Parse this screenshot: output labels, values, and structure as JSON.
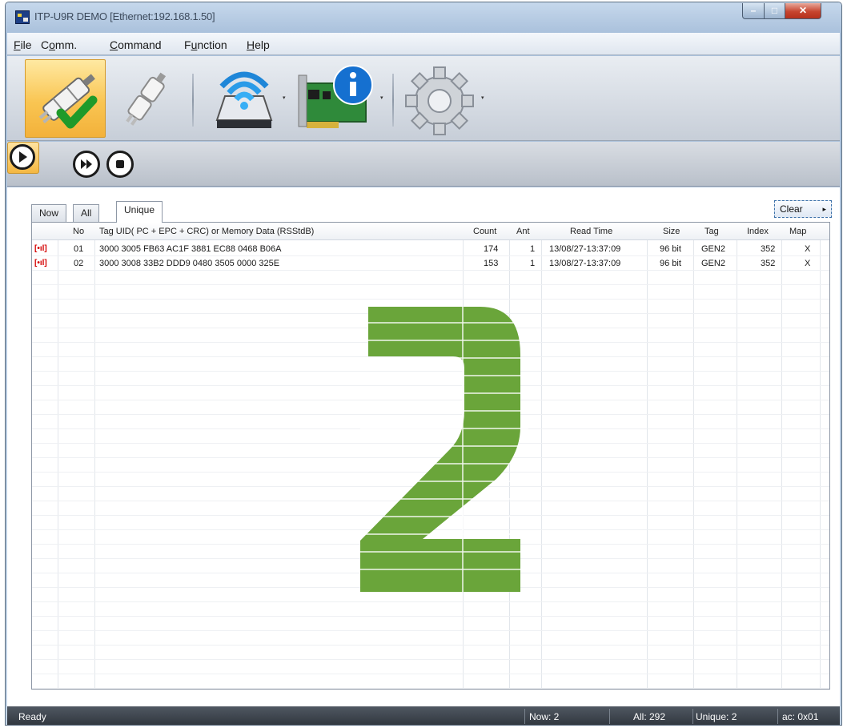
{
  "window": {
    "title": "ITP-U9R DEMO [Ethernet:192.168.1.50]"
  },
  "window_controls": {
    "minimize": "–",
    "maximize": "□",
    "close": "✕"
  },
  "menu": [
    {
      "label": "File",
      "accel": "F",
      "rest": "ile"
    },
    {
      "label": "Comm.",
      "accel": "o",
      "pre": "C",
      "rest": "mm."
    },
    {
      "label": "Command",
      "accel": "C",
      "rest": "ommand"
    },
    {
      "label": "Function",
      "accel": "u",
      "pre": "F",
      "rest": "nction"
    },
    {
      "label": "Help",
      "accel": "H",
      "rest": "elp"
    }
  ],
  "toolbar": {
    "icons": [
      "connect-icon",
      "disconnect-icon",
      "wireless-reader-icon",
      "device-info-icon",
      "settings-gear-icon"
    ],
    "dropdown_arrow": "▾"
  },
  "playback": {
    "icons": [
      "play-icon",
      "fast-forward-icon",
      "stop-icon"
    ]
  },
  "tabs": [
    {
      "label": "Now",
      "active": false
    },
    {
      "label": "All",
      "active": false
    },
    {
      "label": "Unique",
      "active": true
    }
  ],
  "clear_button": {
    "label": "Clear",
    "arrow": "▸"
  },
  "table": {
    "columns": {
      "no": "No",
      "tag": "Tag UID( PC + EPC + CRC) or Memory Data (RSStdB)",
      "count": "Count",
      "ant": "Ant",
      "read_time": "Read Time",
      "size": "Size",
      "tagtype": "Tag",
      "index": "Index",
      "map": "Map"
    },
    "rows": [
      {
        "icon": "rfid-tag-icon",
        "icon_text": "[•ıl]",
        "no": "01",
        "tag": "3000 3005 FB63 AC1F 3881 EC88 0468 B06A",
        "count": "174",
        "ant": "1",
        "read_time": "13/08/27-13:37:09",
        "size": "96 bit",
        "tagtype": "GEN2",
        "index": "352",
        "map": "X"
      },
      {
        "icon": "rfid-tag-icon",
        "icon_text": "[•ıl]",
        "no": "02",
        "tag": "3000 3008 33B2 DDD9 0480 3505 0000 325E",
        "count": "153",
        "ant": "1",
        "read_time": "13/08/27-13:37:09",
        "size": "96 bit",
        "tagtype": "GEN2",
        "index": "352",
        "map": "X"
      }
    ]
  },
  "big_count": {
    "value": 2,
    "color": "#6aa53a"
  },
  "status": {
    "left": "Ready",
    "now": "Now: 2",
    "all": "All: 292",
    "unique": "Unique: 2",
    "addr": "ac: 0x01"
  },
  "colors": {
    "accent_orange": "#f7c04c",
    "tag_icon_red": "#d40000",
    "statusbar": "#3a4048"
  }
}
